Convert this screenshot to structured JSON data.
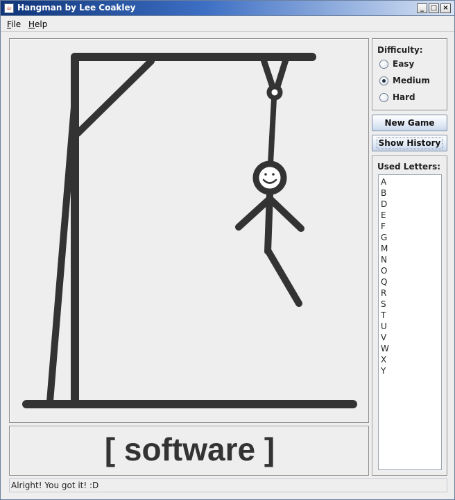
{
  "window": {
    "title": "Hangman by Lee Coakley",
    "controls": {
      "minimize": "_",
      "maximize": "□",
      "close": "×"
    }
  },
  "menu": {
    "items": [
      {
        "label": "File",
        "mnemonic": "F",
        "rest": "ile"
      },
      {
        "label": "Help",
        "mnemonic": "H",
        "rest": "elp"
      }
    ]
  },
  "difficulty": {
    "label": "Difficulty:",
    "options": [
      {
        "label": "Easy",
        "selected": false
      },
      {
        "label": "Medium",
        "selected": true
      },
      {
        "label": "Hard",
        "selected": false
      }
    ]
  },
  "buttons": {
    "new_game": "New Game",
    "show_history": "Show History"
  },
  "used_letters": {
    "label": "Used Letters:",
    "letters": [
      "A",
      "B",
      "D",
      "E",
      "F",
      "G",
      "M",
      "N",
      "O",
      "Q",
      "R",
      "S",
      "T",
      "U",
      "V",
      "W",
      "X",
      "Y"
    ]
  },
  "word": {
    "display": "[ software ]"
  },
  "status": {
    "message": "Alright! You got it! :D"
  },
  "colors": {
    "drawing": "#333333",
    "panel_bg": "#eeeeee",
    "title_gradient_start": "#0f3478"
  }
}
